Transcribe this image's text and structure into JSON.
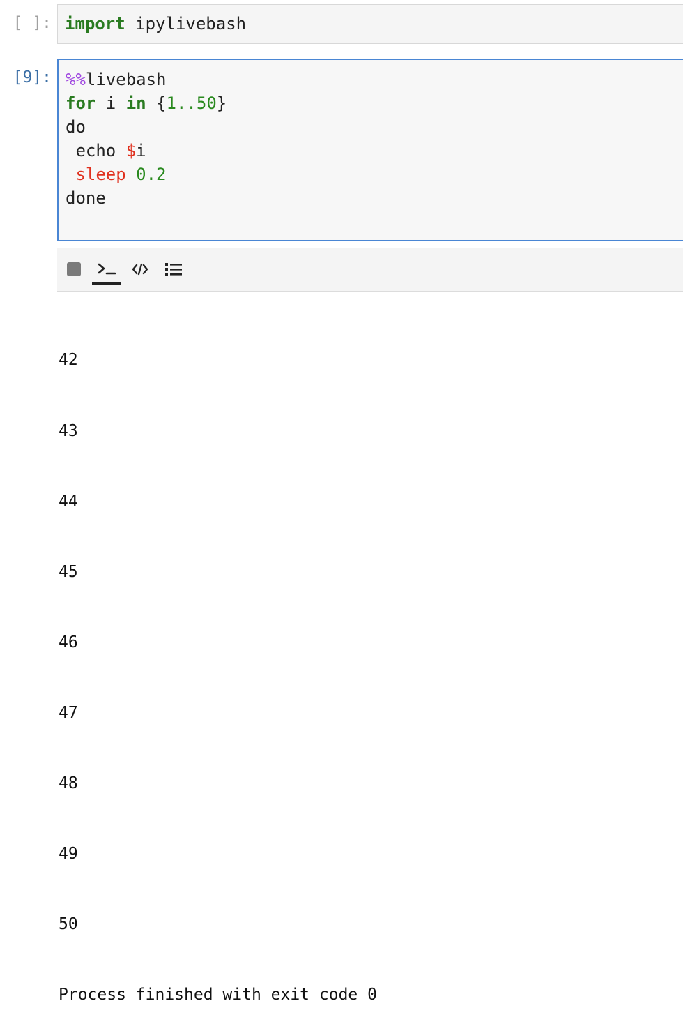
{
  "cells": [
    {
      "prompt": "[ ]:",
      "code": {
        "import_kw": "import",
        "module": " ipylivebash"
      }
    },
    {
      "prompt": "[9]:",
      "code": {
        "line1_pct": "%%",
        "line1_rest": "livebash",
        "line2_for": "for",
        "line2_var": " i ",
        "line2_in": "in",
        "line2_open": " {",
        "line2_range": "1..50",
        "line2_close": "}",
        "line3": "do",
        "line4_cmd": " echo ",
        "line4_var": "$",
        "line4_rest": "i",
        "line5_sleep": " sleep",
        "line5_space": " ",
        "line5_num": "0.2",
        "line6": "done"
      }
    }
  ],
  "toolbar": {
    "stop_icon": "stop-icon",
    "terminal_icon": "terminal-icon",
    "code_icon": "code-icon",
    "list_icon": "list-icon",
    "terminal_symbol": "›_",
    "code_symbol": "</>"
  },
  "output": {
    "lines": [
      "42",
      "43",
      "44",
      "45",
      "46",
      "47",
      "48",
      "49",
      "50",
      "Process finished with exit code 0"
    ]
  },
  "colors": {
    "active_border": "#4a86d4",
    "prompt_active": "#3a6ea5",
    "keyword": "#2a7b21",
    "magic": "#a04ae0",
    "shell_builtin": "#e0301e"
  }
}
